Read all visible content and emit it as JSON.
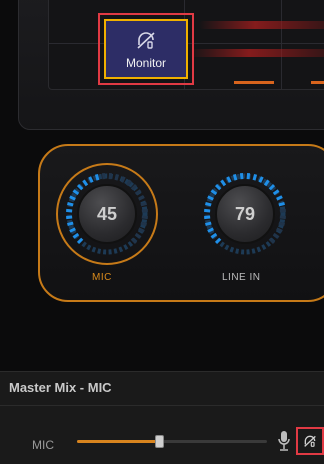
{
  "monitor_button": {
    "label": "Monitor",
    "icon": "monitor-headphone-icon"
  },
  "knobs": [
    {
      "label": "MIC",
      "value": "45",
      "level": 45,
      "label_color": "#d98a1c",
      "active": true
    },
    {
      "label": "LINE IN",
      "value": "79",
      "level": 79,
      "label_color": "#bdbdbd",
      "active": false
    }
  ],
  "footer": {
    "title": "Master Mix - MIC",
    "mic_label": "MIC",
    "slider_level": 0.43
  },
  "colors": {
    "accent_orange": "#c67a18",
    "knob_blue": "#1f8fe8",
    "highlight_red": "#e13a44",
    "monitor_yellow": "#f0b000",
    "monitor_bg": "#2d2d66"
  },
  "icons": [
    "monitor-headphone-icon",
    "microphone-icon"
  ]
}
